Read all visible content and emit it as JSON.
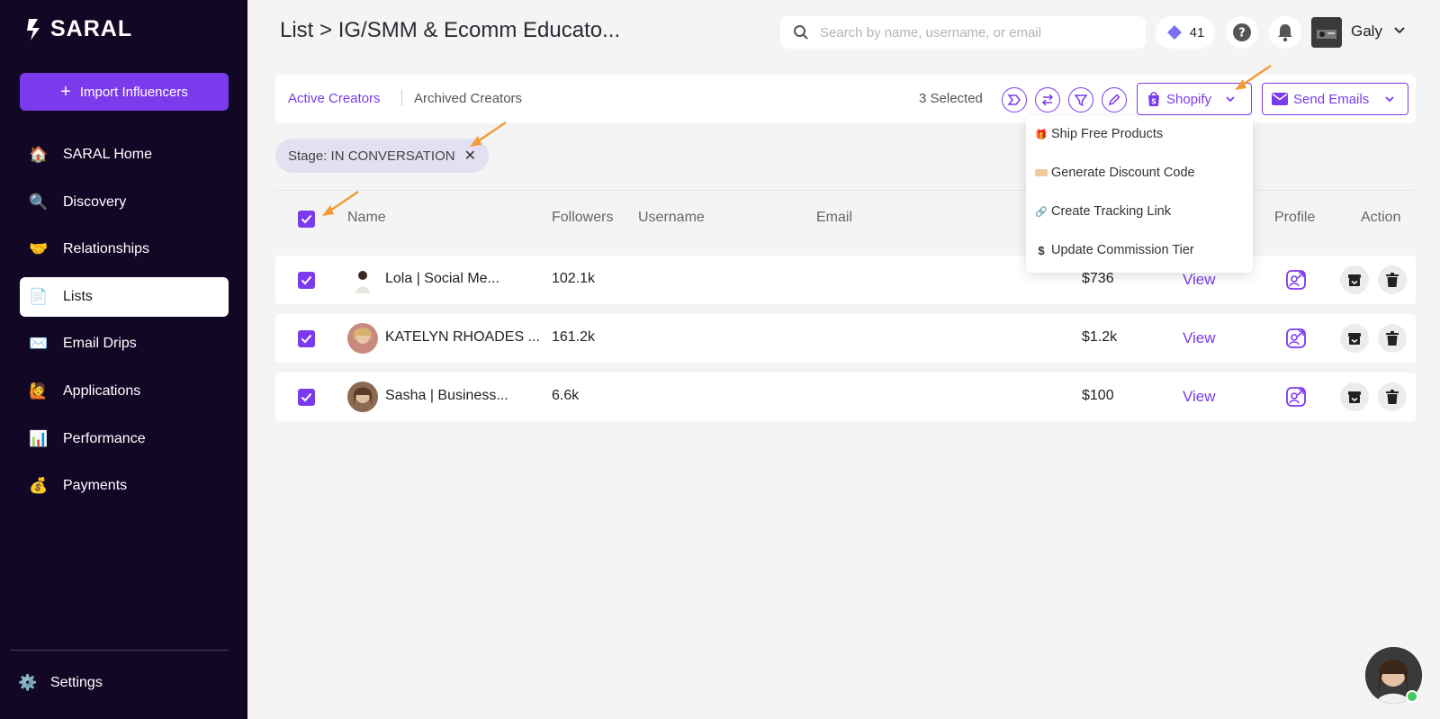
{
  "brand": {
    "name": "SARAL"
  },
  "sidebar": {
    "import_label": "Import Influencers",
    "items": [
      {
        "label": "SARAL Home",
        "icon": "house-icon"
      },
      {
        "label": "Discovery",
        "icon": "magnifier-icon"
      },
      {
        "label": "Relationships",
        "icon": "handshake-icon"
      },
      {
        "label": "Lists",
        "icon": "page-icon",
        "active": true
      },
      {
        "label": "Email Drips",
        "icon": "envelope-icon"
      },
      {
        "label": "Applications",
        "icon": "raising-hand-icon"
      },
      {
        "label": "Performance",
        "icon": "bar-chart-icon"
      },
      {
        "label": "Payments",
        "icon": "money-bag-icon"
      }
    ],
    "settings_label": "Settings"
  },
  "header": {
    "title": "List > IG/SMM & Ecomm Educato...",
    "search_placeholder": "Search by name, username, or email",
    "credits": "41",
    "user_name": "Galy"
  },
  "toolbar": {
    "tab_active": "Active Creators",
    "tab_archived": "Archived Creators",
    "selected": "3 Selected",
    "shopify_label": "Shopify",
    "send_label": "Send Emails"
  },
  "filter_chip": {
    "label": "Stage: IN CONVERSATION"
  },
  "table": {
    "headers": {
      "name": "Name",
      "followers": "Followers",
      "username": "Username",
      "email": "Email",
      "profile": "Profile",
      "action": "Action"
    },
    "rows": [
      {
        "name": "Lola | Social Me...",
        "followers": "102.1k",
        "price": "$736",
        "view": "View"
      },
      {
        "name": "KATELYN RHOADES ...",
        "followers": "161.2k",
        "price": "$1.2k",
        "view": "View"
      },
      {
        "name": "Sasha | Business...",
        "followers": "6.6k",
        "price": "$100",
        "view": "View"
      }
    ]
  },
  "dropdown": {
    "items": [
      {
        "label": "Ship Free Products",
        "icon": "gift-icon"
      },
      {
        "label": "Generate Discount Code",
        "icon": "ticket-icon"
      },
      {
        "label": "Create Tracking Link",
        "icon": "link-icon"
      },
      {
        "label": "Update Commission Tier",
        "icon": "dollar-icon"
      }
    ]
  },
  "colors": {
    "accent": "#7c3aed",
    "sidebar_bg": "#120826",
    "annotation_arrow": "#f29b38"
  }
}
